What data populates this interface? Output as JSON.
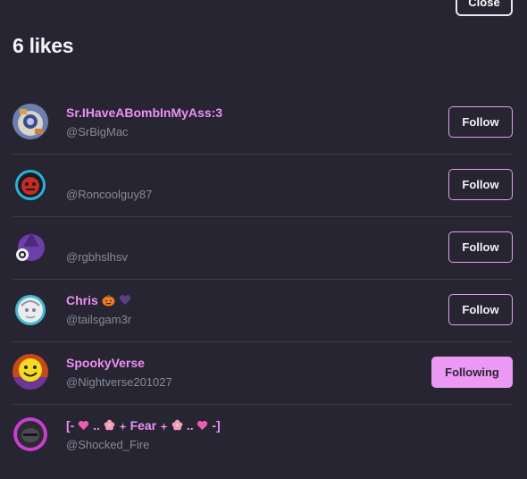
{
  "header": {
    "close_label": "Close",
    "title": "6 likes"
  },
  "likes": [
    {
      "name": "Sr.IHaveABombInMyAss:3",
      "handle": "@SrBigMac",
      "button_label": "Follow",
      "following": false,
      "avatar_icon": "sunglasses-character-avatar"
    },
    {
      "name": "",
      "handle": "@Roncoolguy87",
      "button_label": "Follow",
      "following": false,
      "avatar_icon": "red-mask-avatar"
    },
    {
      "name": "",
      "handle": "@rgbhslhsv",
      "button_label": "Follow",
      "following": false,
      "avatar_icon": "purple-wizard-avatar"
    },
    {
      "name": "Chris",
      "name_emojis": [
        "pumpkin-emoji",
        "purple-heart-emoji"
      ],
      "handle": "@tailsgam3r",
      "button_label": "Follow",
      "following": false,
      "avatar_icon": "sketch-character-avatar"
    },
    {
      "name": "SpookyVerse",
      "handle": "@Nightverse201027",
      "button_label": "Following",
      "following": true,
      "avatar_icon": "yellow-smiley-avatar"
    },
    {
      "name_parts": [
        "[-",
        "..",
        "Fear",
        "..",
        "-]"
      ],
      "handle": "@Shocked_Fire",
      "button_label": "",
      "following": false,
      "avatar_icon": "dark-helmet-avatar"
    }
  ],
  "colors": {
    "background": "#262531",
    "accent": "#eb99f2",
    "name": "#ef8ff7",
    "handle": "#8a8997",
    "divider": "#3b3a47"
  }
}
